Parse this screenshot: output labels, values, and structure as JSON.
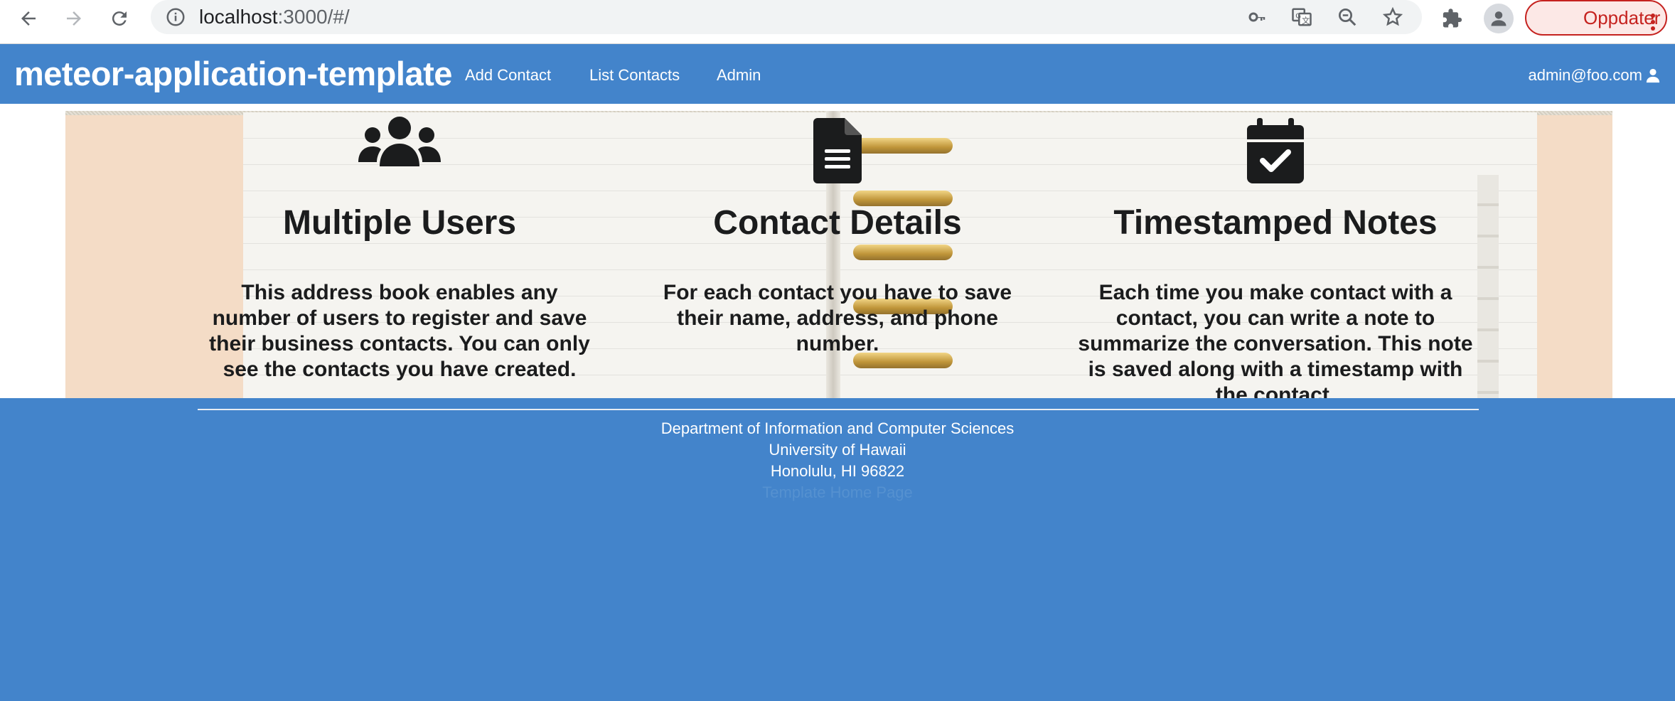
{
  "browser": {
    "url_host": "localhost",
    "url_path": ":3000/#/",
    "update_label": "Oppdater"
  },
  "navbar": {
    "brand": "meteor-application-template",
    "links": [
      "Add Contact",
      "List Contacts",
      "Admin"
    ],
    "user": "admin@foo.com"
  },
  "features": [
    {
      "icon": "users-icon",
      "title": "Multiple Users",
      "text": "This address book enables any number of users to register and save their business contacts. You can only see the contacts you have created."
    },
    {
      "icon": "file-icon",
      "title": "Contact Details",
      "text": "For each contact you have to save their name, address, and phone number."
    },
    {
      "icon": "calendar-check-icon",
      "title": "Timestamped Notes",
      "text": "Each time you make contact with a contact, you can write a note to summarize the conversation. This note is saved along with a timestamp with the contact."
    }
  ],
  "footer": {
    "line1": "Department of Information and Computer Sciences",
    "line2": "University of Hawaii",
    "line3": "Honolulu, HI 96822",
    "line4": "Template Home Page"
  },
  "colors": {
    "primary": "#4384cb",
    "text_dark": "#1b1c1d",
    "update_red": "#c5221f"
  }
}
